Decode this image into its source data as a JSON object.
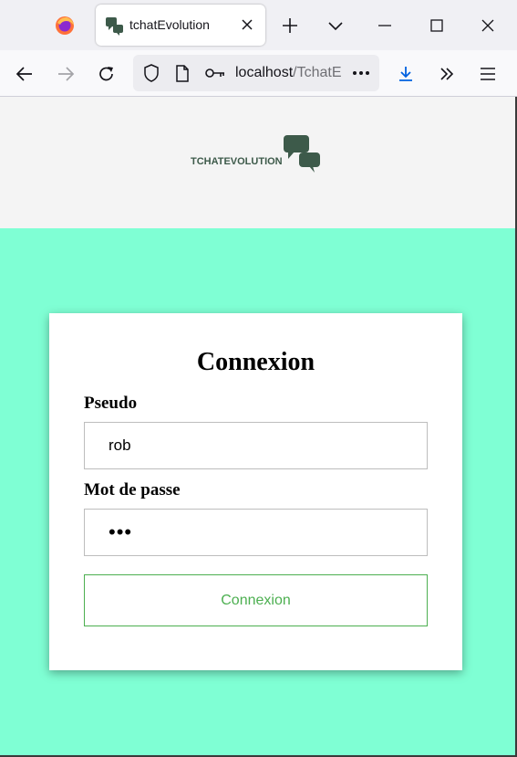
{
  "browser": {
    "tab": {
      "title": "tchatEvolution"
    },
    "url": {
      "host": "localhost",
      "path": "/TchatE"
    },
    "icons": {
      "firefox": "firefox-logo",
      "new_tab": "plus-icon",
      "tab_list": "chevron-down-icon",
      "minimize": "minimize-icon",
      "maximize": "maximize-icon",
      "close": "close-icon",
      "back": "back-arrow-icon",
      "forward": "forward-arrow-icon",
      "reload": "reload-icon",
      "shield": "shield-icon",
      "page": "page-icon",
      "key": "key-icon",
      "more": "more-dots-icon",
      "download": "download-icon",
      "overflow": "double-chevron-icon",
      "menu": "hamburger-menu-icon"
    }
  },
  "header": {
    "logo_text": "TCHATEVOLUTION"
  },
  "login": {
    "title": "Connexion",
    "pseudo_label": "Pseudo",
    "pseudo_value": "rob",
    "password_label": "Mot de passe",
    "password_value": "•••",
    "submit_label": "Connexion"
  },
  "colors": {
    "page_background": "#7fffd4",
    "header_background": "#f4f4f4",
    "accent_green": "#4caf50",
    "logo_green": "#3d5a4a"
  }
}
